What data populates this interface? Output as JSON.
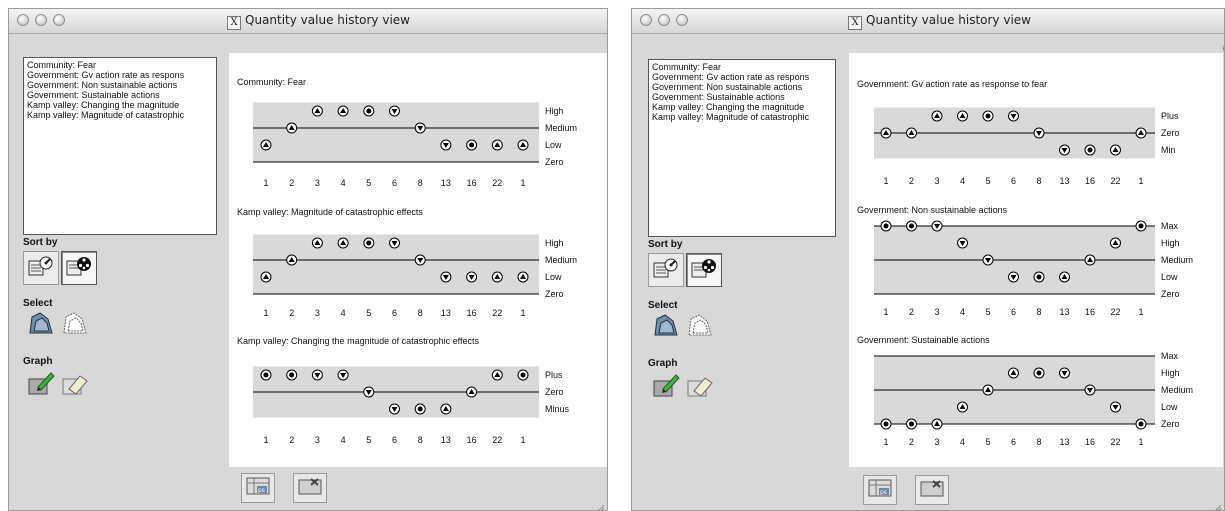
{
  "windows": [
    {
      "title": "Quantity value history view",
      "quantities": [
        "Community: Fear",
        "Government: Gv action rate as respons",
        "Government: Non sustainable actions",
        "Government: Sustainable actions",
        "Kamp valley: Changing the magnitude",
        "Kamp valley: Magnitude of catastrophic"
      ],
      "sort_label": "Sort by",
      "select_label": "Select",
      "graph_label": "Graph",
      "graphs": [
        {
          "title": "Community: Fear",
          "levels": [
            "High",
            "Medium",
            "Low",
            "Zero"
          ],
          "level_kind": [
            "interval",
            "point",
            "interval",
            "point"
          ],
          "x_labels": [
            "1",
            "2",
            "3",
            "4",
            "5",
            "6",
            "8",
            "13",
            "16",
            "22",
            "1"
          ],
          "states": [
            {
              "level": "Low",
              "dir": "up"
            },
            {
              "level": "Medium",
              "dir": "up"
            },
            {
              "level": "High",
              "dir": "up"
            },
            {
              "level": "High",
              "dir": "up"
            },
            {
              "level": "High",
              "dir": "steady"
            },
            {
              "level": "High",
              "dir": "down"
            },
            {
              "level": "Medium",
              "dir": "down"
            },
            {
              "level": "Low",
              "dir": "down"
            },
            {
              "level": "Low",
              "dir": "steady"
            },
            {
              "level": "Low",
              "dir": "up"
            },
            {
              "level": "Low",
              "dir": "up"
            }
          ]
        },
        {
          "title": "Kamp valley: Magnitude of catastrophic effects",
          "levels": [
            "High",
            "Medium",
            "Low",
            "Zero"
          ],
          "level_kind": [
            "interval",
            "point",
            "interval",
            "point"
          ],
          "x_labels": [
            "1",
            "2",
            "3",
            "4",
            "5",
            "6",
            "8",
            "13",
            "16",
            "22",
            "1"
          ],
          "states": [
            {
              "level": "Low",
              "dir": "up"
            },
            {
              "level": "Medium",
              "dir": "up"
            },
            {
              "level": "High",
              "dir": "up"
            },
            {
              "level": "High",
              "dir": "up"
            },
            {
              "level": "High",
              "dir": "steady"
            },
            {
              "level": "High",
              "dir": "down"
            },
            {
              "level": "Medium",
              "dir": "down"
            },
            {
              "level": "Low",
              "dir": "down"
            },
            {
              "level": "Low",
              "dir": "down"
            },
            {
              "level": "Low",
              "dir": "up"
            },
            {
              "level": "Low",
              "dir": "up"
            }
          ]
        },
        {
          "title": "Kamp valley: Changing the magnitude of catastrophic effects",
          "levels": [
            "Plus",
            "Zero",
            "Minus"
          ],
          "level_kind": [
            "interval",
            "point",
            "interval"
          ],
          "x_labels": [
            "1",
            "2",
            "3",
            "4",
            "5",
            "6",
            "8",
            "13",
            "16",
            "22",
            "1"
          ],
          "states": [
            {
              "level": "Plus",
              "dir": "steady"
            },
            {
              "level": "Plus",
              "dir": "steady"
            },
            {
              "level": "Plus",
              "dir": "down"
            },
            {
              "level": "Plus",
              "dir": "down"
            },
            {
              "level": "Zero",
              "dir": "down"
            },
            {
              "level": "Minus",
              "dir": "down"
            },
            {
              "level": "Minus",
              "dir": "steady"
            },
            {
              "level": "Minus",
              "dir": "up"
            },
            {
              "level": "Zero",
              "dir": "up"
            },
            {
              "level": "Plus",
              "dir": "up"
            },
            {
              "level": "Plus",
              "dir": "steady"
            }
          ]
        }
      ]
    },
    {
      "title": "Quantity value history view",
      "quantities": [
        "Community: Fear",
        "Government: Gv action rate as respons",
        "Government: Non sustainable actions",
        "Government: Sustainable actions",
        "Kamp valley: Changing the magnitude",
        "Kamp valley: Magnitude of catastrophic"
      ],
      "sort_label": "Sort by",
      "select_label": "Select",
      "graph_label": "Graph",
      "graphs": [
        {
          "title": "Government: Gv action rate as response to fear",
          "levels": [
            "Plus",
            "Zero",
            "Min"
          ],
          "level_kind": [
            "interval",
            "point",
            "interval"
          ],
          "x_labels": [
            "1",
            "2",
            "3",
            "4",
            "5",
            "6",
            "8",
            "13",
            "16",
            "22",
            "1"
          ],
          "states": [
            {
              "level": "Zero",
              "dir": "up"
            },
            {
              "level": "Zero",
              "dir": "up"
            },
            {
              "level": "Plus",
              "dir": "up"
            },
            {
              "level": "Plus",
              "dir": "up"
            },
            {
              "level": "Plus",
              "dir": "steady"
            },
            {
              "level": "Plus",
              "dir": "down"
            },
            {
              "level": "Zero",
              "dir": "down"
            },
            {
              "level": "Min",
              "dir": "down"
            },
            {
              "level": "Min",
              "dir": "steady"
            },
            {
              "level": "Min",
              "dir": "up"
            },
            {
              "level": "Zero",
              "dir": "up"
            }
          ]
        },
        {
          "title": "Government: Non sustainable actions",
          "levels": [
            "Max",
            "High",
            "Medium",
            "Low",
            "Zero"
          ],
          "level_kind": [
            "point",
            "interval",
            "point",
            "interval",
            "point"
          ],
          "x_labels": [
            "1",
            "2",
            "3",
            "4",
            "5",
            "6",
            "8",
            "13",
            "16",
            "22",
            "1"
          ],
          "states": [
            {
              "level": "Max",
              "dir": "steady"
            },
            {
              "level": "Max",
              "dir": "steady"
            },
            {
              "level": "Max",
              "dir": "down"
            },
            {
              "level": "High",
              "dir": "down"
            },
            {
              "level": "Medium",
              "dir": "down"
            },
            {
              "level": "Low",
              "dir": "down"
            },
            {
              "level": "Low",
              "dir": "steady"
            },
            {
              "level": "Low",
              "dir": "up"
            },
            {
              "level": "Medium",
              "dir": "up"
            },
            {
              "level": "High",
              "dir": "up"
            },
            {
              "level": "Max",
              "dir": "steady"
            }
          ]
        },
        {
          "title": "Government: Sustainable actions",
          "levels": [
            "Max",
            "High",
            "Medium",
            "Low",
            "Zero"
          ],
          "level_kind": [
            "point",
            "interval",
            "point",
            "interval",
            "point"
          ],
          "x_labels": [
            "1",
            "2",
            "3",
            "4",
            "5",
            "6",
            "8",
            "13",
            "16",
            "22",
            "1"
          ],
          "states": [
            {
              "level": "Zero",
              "dir": "steady"
            },
            {
              "level": "Zero",
              "dir": "steady"
            },
            {
              "level": "Zero",
              "dir": "up"
            },
            {
              "level": "Low",
              "dir": "up"
            },
            {
              "level": "Medium",
              "dir": "up"
            },
            {
              "level": "High",
              "dir": "up"
            },
            {
              "level": "High",
              "dir": "steady"
            },
            {
              "level": "High",
              "dir": "down"
            },
            {
              "level": "Medium",
              "dir": "down"
            },
            {
              "level": "Low",
              "dir": "down"
            },
            {
              "level": "Zero",
              "dir": "steady"
            }
          ]
        }
      ]
    }
  ],
  "colors": {
    "window_bg": "#d8d8d8",
    "panel_bg": "#ffffff",
    "interval_band": "#d9d9d9",
    "line": "#000000"
  },
  "icons": {
    "sort_buttons": [
      "sort-by-value-icon",
      "sort-by-state-icon"
    ],
    "select_buttons": [
      "select-all-icon",
      "deselect-all-icon"
    ],
    "graph_buttons": [
      "draw-graph-icon",
      "erase-graph-icon"
    ],
    "bottom_buttons": [
      "export-postscript-icon",
      "close-view-icon"
    ],
    "panel_corner": "user-avatar-icon"
  }
}
